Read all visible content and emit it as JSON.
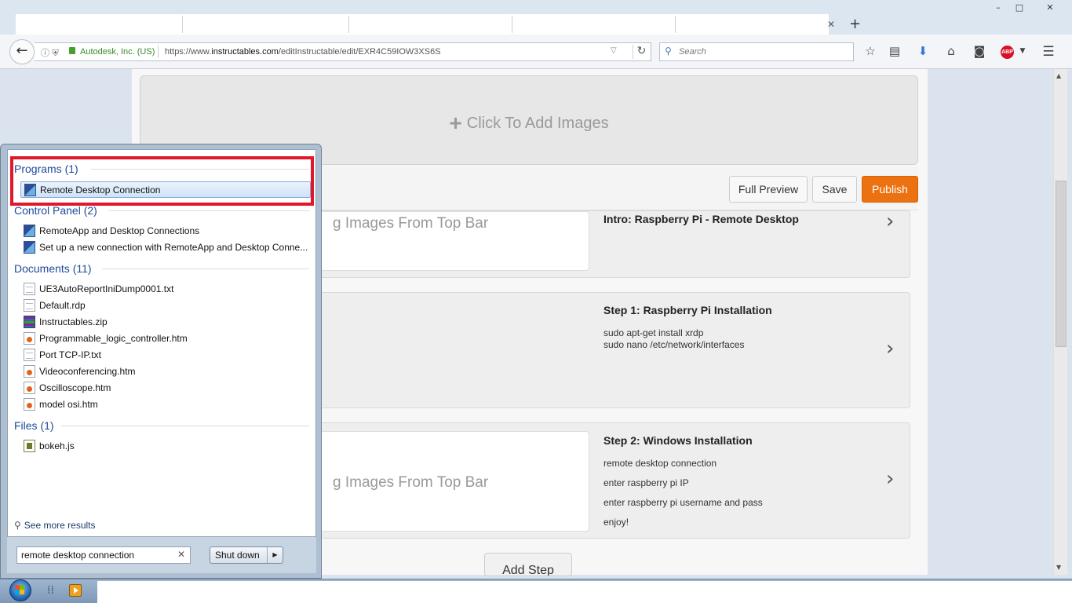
{
  "browser": {
    "window_controls": {
      "minimize": "–",
      "maximize": "□",
      "close": "✕"
    },
    "new_tab": "+",
    "tab_close": "✕",
    "identity": "Autodesk, Inc. (US)",
    "url_prefix": "https://www.",
    "url_domain": "instructables.com",
    "url_path": "/editInstructable/edit/EXR4C59IOW3XS6S",
    "search_placeholder": "Search",
    "icons": [
      "back-arrow-icon",
      "info-icon",
      "shield-icon",
      "lock-icon",
      "dropdown-icon",
      "reload-icon",
      "search-icon",
      "star-icon",
      "reading-list-icon",
      "download-icon",
      "home-icon",
      "pocket-icon",
      "adblock-icon",
      "menu-icon"
    ],
    "adblock_label": "ABP"
  },
  "editor": {
    "add_images": "Click To Add Images",
    "buttons": {
      "full_preview": "Full Preview",
      "save": "Save",
      "publish": "Publish"
    },
    "accent_color": "#ec7211",
    "steps": [
      {
        "title": "Intro: Raspberry Pi - Remote Desktop",
        "image_hint": "g Images From Top Bar",
        "lines": []
      },
      {
        "title": "Step 1: Raspberry Pi Installation",
        "image_hint": "",
        "lines": [
          "sudo apt-get install xrdp",
          "sudo nano /etc/network/interfaces"
        ]
      },
      {
        "title": "Step 2: Windows Installation",
        "image_hint": "g Images From Top Bar",
        "lines": [
          "remote desktop connection",
          "enter raspberry pi IP",
          "enter raspberry pi username and pass",
          "enjoy!"
        ]
      }
    ],
    "add_step": "Add Step"
  },
  "start_menu": {
    "groups": [
      {
        "header": "Programs (1)",
        "items": [
          {
            "label": "Remote Desktop Connection",
            "icon": "rdp-icon",
            "selected": true
          }
        ]
      },
      {
        "header": "Control Panel (2)",
        "items": [
          {
            "label": "RemoteApp and Desktop Connections",
            "icon": "rdp-icon"
          },
          {
            "label": "Set up a new connection with RemoteApp and Desktop Conne...",
            "icon": "rdp-icon"
          }
        ]
      },
      {
        "header": "Documents (11)",
        "items": [
          {
            "label": "UE3AutoReportIniDump0001.txt",
            "icon": "text-file-icon"
          },
          {
            "label": "Default.rdp",
            "icon": "text-file-icon"
          },
          {
            "label": "Instructables.zip",
            "icon": "archive-icon"
          },
          {
            "label": "Programmable_logic_controller.htm",
            "icon": "html-file-icon"
          },
          {
            "label": "Port TCP-IP.txt",
            "icon": "text-file-icon"
          },
          {
            "label": "Videoconferencing.htm",
            "icon": "html-file-icon"
          },
          {
            "label": "Oscilloscope.htm",
            "icon": "html-file-icon"
          },
          {
            "label": "model osi.htm",
            "icon": "html-file-icon"
          }
        ]
      },
      {
        "header": "Files (1)",
        "items": [
          {
            "label": "bokeh.js",
            "icon": "script-file-icon"
          }
        ]
      }
    ],
    "see_more": "See more results",
    "search_value": "remote desktop connection",
    "shutdown_label": "Shut down",
    "highlight_color": "#e0182a"
  }
}
